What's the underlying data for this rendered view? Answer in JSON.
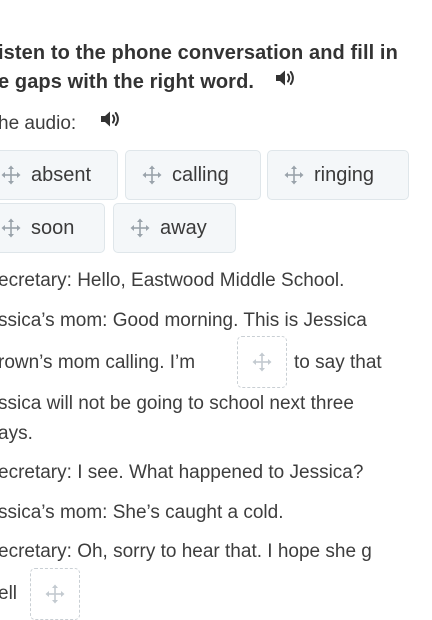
{
  "instructions": {
    "line1": "isten to the phone conversation and fill in",
    "line2": "e gaps with the right word."
  },
  "audio": {
    "label": "he audio:"
  },
  "word_bank": [
    {
      "label": "absent"
    },
    {
      "label": "calling"
    },
    {
      "label": "ringing"
    },
    {
      "label": "soon"
    },
    {
      "label": "away"
    }
  ],
  "dialogue": {
    "line1": "ecretary: Hello, Eastwood Middle School.",
    "line2": "ssica’s mom: Good morning. This is Jessica",
    "line3_before": "rown’s mom calling. I’m",
    "line3_after": "to say that",
    "line4": "ssica will not be going to school next three",
    "line5": "ays.",
    "line6": "ecretary: I see. What happened to Jessica?",
    "line7": "ssica’s mom: She’s caught a cold.",
    "line8": "ecretary: Oh, sorry to hear that. I hope she g",
    "line9_before": "ell"
  },
  "colors": {
    "chip_bg": "#f4f7f9",
    "chip_border": "#dfe6ea",
    "icon": "#9aa3ab",
    "text": "#3a3a3a"
  }
}
